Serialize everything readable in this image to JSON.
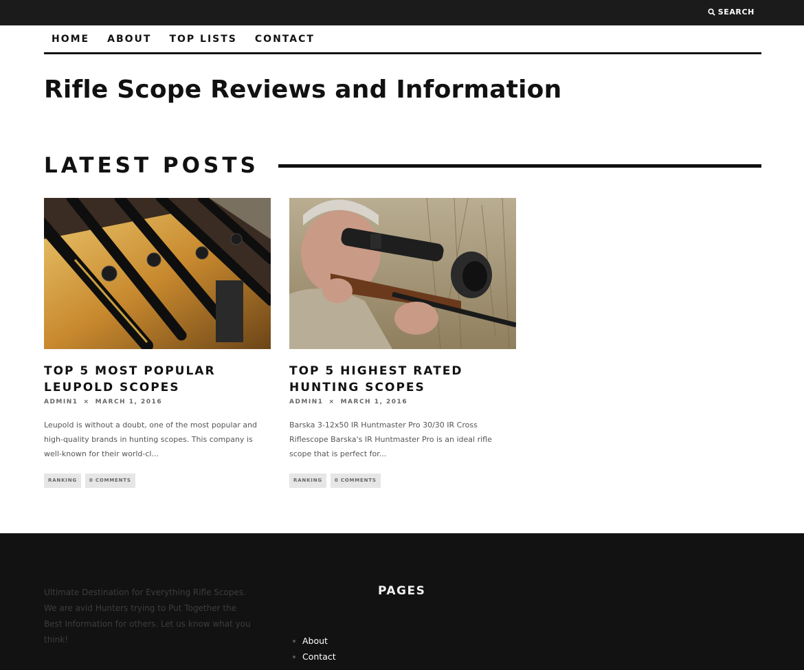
{
  "topbar": {
    "search_label": "SEARCH",
    "search_icon": "search-icon"
  },
  "nav": {
    "items": [
      "HOME",
      "ABOUT",
      "TOP LISTS",
      "CONTACT"
    ]
  },
  "site_title": "Rifle Scope Reviews and Information",
  "section": {
    "title": "LATEST POSTS"
  },
  "posts": [
    {
      "title_line1": "TOP 5 MOST POPULAR",
      "title_line2": "LEUPOLD SCOPES",
      "author": "ADMIN1",
      "separator": "×",
      "date": "MARCH 1, 2016",
      "excerpt": "Leupold is without a doubt, one of the most popular and high-quality brands in hunting scopes. This company is well-known for their world-cl...",
      "tags": [
        "RANKING",
        "0 COMMENTS"
      ],
      "image": "rifle-rack-scopes-photo"
    },
    {
      "title_line1": "TOP 5 HIGHEST RATED",
      "title_line2": "HUNTING SCOPES",
      "author": "ADMIN1",
      "separator": "×",
      "date": "MARCH 1, 2016",
      "excerpt": "Barska 3-12x50 IR Huntmaster Pro 30/30 IR Cross Riflescope Barska's IR Huntmaster Pro is an ideal rifle scope that is perfect for...",
      "tags": [
        "RANKING",
        "0 COMMENTS"
      ],
      "image": "hunter-aiming-rifle-photo"
    }
  ],
  "footer": {
    "about_text": "Ultimate Destination for Everything Rifle Scopes. We are avid Hunters trying to Put Together the Best Information for others. Let us know what you think!",
    "pages_title": "PAGES",
    "pages": [
      "About",
      "Contact"
    ]
  },
  "colors": {
    "topbar": "#1b1b1b",
    "footer": "#121212",
    "text": "#111111",
    "tag_bg": "#e6e6e6"
  }
}
